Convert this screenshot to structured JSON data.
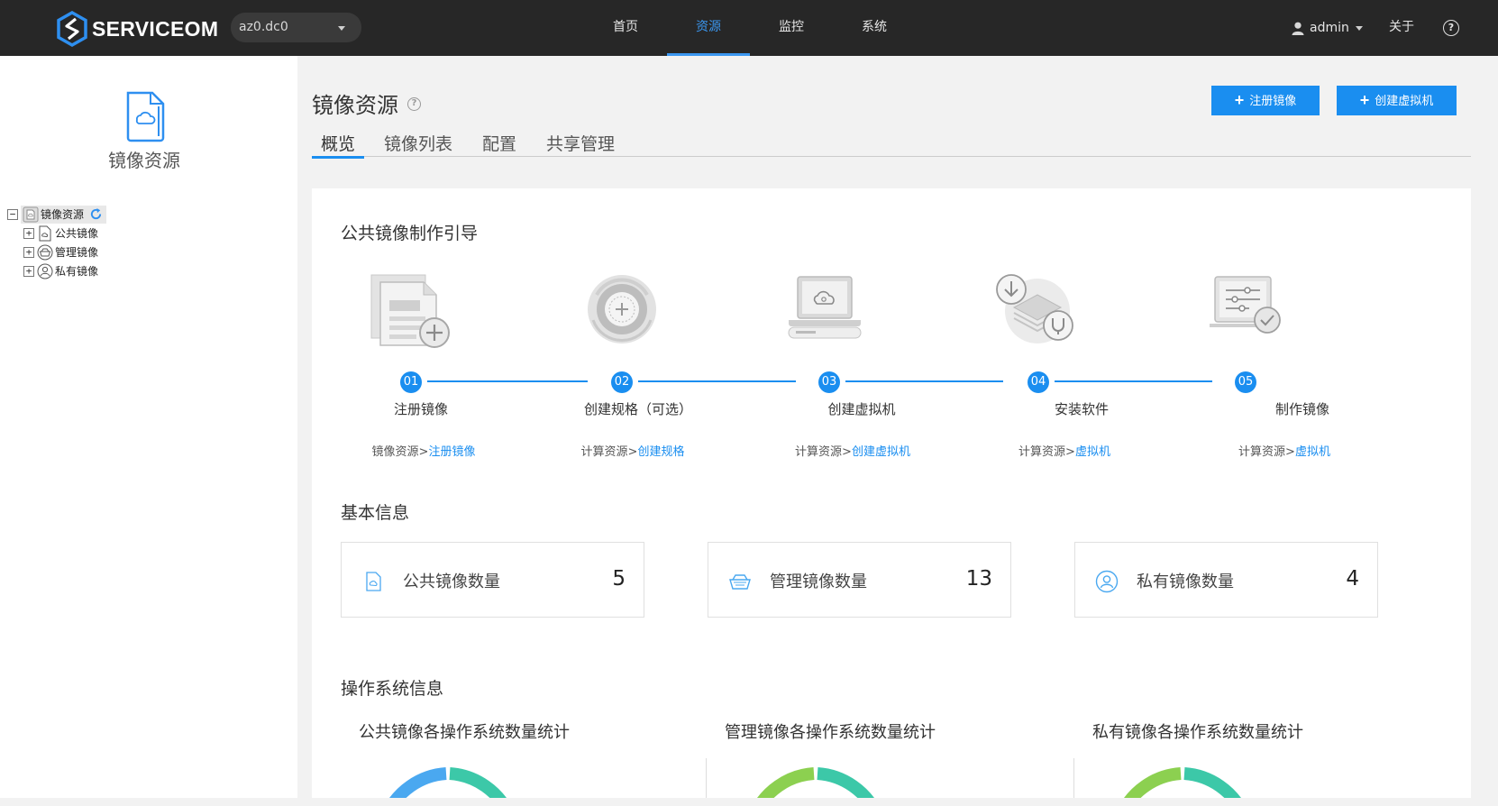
{
  "header": {
    "logo_text_a": "SERVICE",
    "logo_text_b": "OM",
    "az_value": "az0.dc0",
    "nav": [
      {
        "label": "首页",
        "active": false
      },
      {
        "label": "资源",
        "active": true
      },
      {
        "label": "监控",
        "active": false
      },
      {
        "label": "系统",
        "active": false
      }
    ],
    "user": "admin",
    "about": "关于",
    "help_glyph": "?"
  },
  "sidebar": {
    "title": "镜像资源",
    "tree": {
      "root": "镜像资源",
      "children": [
        "公共镜像",
        "管理镜像",
        "私有镜像"
      ]
    },
    "expander_glyph": "+",
    "collapse_glyph": "−"
  },
  "page": {
    "title": "镜像资源",
    "help_glyph": "?",
    "buttons": {
      "register": "注册镜像",
      "create_vm": "创建虚拟机",
      "plus": "+"
    },
    "tabs": [
      "概览",
      "镜像列表",
      "配置",
      "共享管理"
    ]
  },
  "guide": {
    "title": "公共镜像制作引导",
    "steps": [
      {
        "num": "01",
        "label": "注册镜像",
        "prefix": "镜像资源>",
        "link": "注册镜像",
        "icon": "document-add-icon"
      },
      {
        "num": "02",
        "label": "创建规格（可选）",
        "prefix": "计算资源>",
        "link": "创建规格",
        "icon": "disc-add-icon"
      },
      {
        "num": "03",
        "label": "创建虚拟机",
        "prefix": "计算资源>",
        "link": "创建虚拟机",
        "icon": "laptop-cloud-icon"
      },
      {
        "num": "04",
        "label": "安装软件",
        "prefix": "计算资源>",
        "link": "虚拟机",
        "icon": "install-software-icon"
      },
      {
        "num": "05",
        "label": "制作镜像",
        "prefix": "计算资源>",
        "link": "虚拟机",
        "icon": "settings-check-icon"
      }
    ]
  },
  "basic": {
    "title": "基本信息",
    "stats": [
      {
        "label": "公共镜像数量",
        "value": "5",
        "icon": "public-image-icon"
      },
      {
        "label": "管理镜像数量",
        "value": "13",
        "icon": "manage-image-icon"
      },
      {
        "label": "私有镜像数量",
        "value": "4",
        "icon": "private-image-icon"
      }
    ]
  },
  "os": {
    "title": "操作系统信息",
    "charts": [
      {
        "title": "公共镜像各操作系统数量统计",
        "colors": [
          "#4aa8f0",
          "#3cc8a8"
        ]
      },
      {
        "title": "管理镜像各操作系统数量统计",
        "colors": [
          "#8cd050",
          "#3cc8a8"
        ]
      },
      {
        "title": "私有镜像各操作系统数量统计",
        "colors": [
          "#8cd050",
          "#3cc8a8"
        ]
      }
    ]
  }
}
